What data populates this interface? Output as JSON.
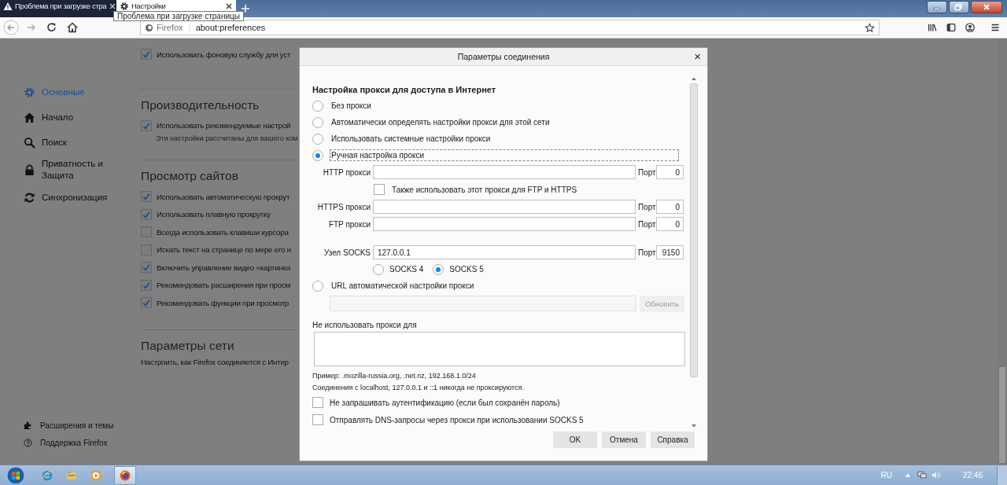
{
  "tabs": [
    {
      "label": "Проблема при загрузке стра",
      "selected": false,
      "kind": "warning"
    },
    {
      "label": "Настройки",
      "selected": true,
      "kind": "settings"
    }
  ],
  "tooltip": "Проблема при загрузке страницы",
  "address_bar": {
    "identity": "Firefox",
    "url": "about:preferences"
  },
  "sidebar": {
    "items": [
      {
        "label": "Основные",
        "selected": true
      },
      {
        "label": "Начало",
        "selected": false
      },
      {
        "label": "Поиск",
        "selected": false
      },
      {
        "label": "Приватность и Защита",
        "selected": false
      },
      {
        "label": "Синхронизация",
        "selected": false
      }
    ],
    "footer": [
      {
        "label": "Расширения и темы"
      },
      {
        "label": "Поддержка Firefox"
      }
    ]
  },
  "sections": [
    {
      "items": [
        {
          "label": "Использовать фоновую службу для уст",
          "checked": true
        }
      ]
    },
    {
      "heading": "Производительность",
      "items": [
        {
          "label": "Использовать рекомендуемые настрой",
          "checked": true
        }
      ],
      "note": "Эти настройки рассчитаны для вашего ком"
    },
    {
      "heading": "Просмотр сайтов",
      "items": [
        {
          "label": "Использовать автоматическую прокрут",
          "checked": true
        },
        {
          "label": "Использовать плавную прокрутку",
          "checked": true
        },
        {
          "label": "Всегда использовать клавиши курсора",
          "checked": false
        },
        {
          "label": "Искать текст на странице по мере его н",
          "checked": false
        },
        {
          "label": "Включить управление видео «картинка",
          "checked": true
        },
        {
          "label": "Рекомендовать расширения при просм",
          "checked": true
        },
        {
          "label": "Рекомендовать функции при просмотр",
          "checked": true
        }
      ]
    },
    {
      "heading": "Параметры сети",
      "text": "Настроить, как Firefox соединяется с Интер"
    }
  ],
  "dialog": {
    "title": "Параметры соединения",
    "close": "×",
    "heading": "Настройка прокси для доступа в Интернет",
    "modes": [
      {
        "label": "Без прокси",
        "selected": false
      },
      {
        "label": "Автоматически определять настройки прокси для этой сети",
        "selected": false
      },
      {
        "label": "Использовать системные настройки прокси",
        "selected": false
      },
      {
        "label": "Ручная настройка прокси",
        "selected": true
      }
    ],
    "proxy_fields": [
      {
        "label": "HTTP прокси",
        "port_label": "Порт",
        "port": "0"
      },
      {
        "kind": "checkbox",
        "label": "Также использовать этот прокси для FTP и HTTPS",
        "checked": false
      },
      {
        "label": "HTTPS прокси",
        "port_label": "Порт",
        "port": "0"
      },
      {
        "label": "FTP прокси",
        "port_label": "Порт",
        "port": "0"
      },
      {
        "kind": "gap"
      },
      {
        "label": "Узел SOCKS",
        "value": "127.0.0.1",
        "port_label": "Порт",
        "port": "9150"
      }
    ],
    "socks_versions": [
      {
        "label": "SOCKS 4",
        "selected": false
      },
      {
        "label": "SOCKS 5",
        "selected": true
      }
    ],
    "auto_url": {
      "label": "URL автоматической настройки прокси",
      "selected": false,
      "disabled": true,
      "reload_button": "Обновить"
    },
    "no_proxy_label": "Не использовать прокси для",
    "hints": [
      "Пример: .mozilla-russia.org, .net.nz, 192.168.1.0/24",
      "Соединения с localhost, 127.0.0.1 и ::1 никогда не проксируются."
    ],
    "options": [
      {
        "label": "Не запрашивать аутентификацию (если был сохранён пароль)",
        "checked": false
      },
      {
        "label": "Отправлять DNS-запросы через прокси при использовании SOCKS 5",
        "checked": false
      }
    ],
    "buttons": [
      "OK",
      "Отмена",
      "Справка"
    ]
  },
  "taskbar": {
    "language": "RU",
    "time": "22:46"
  }
}
